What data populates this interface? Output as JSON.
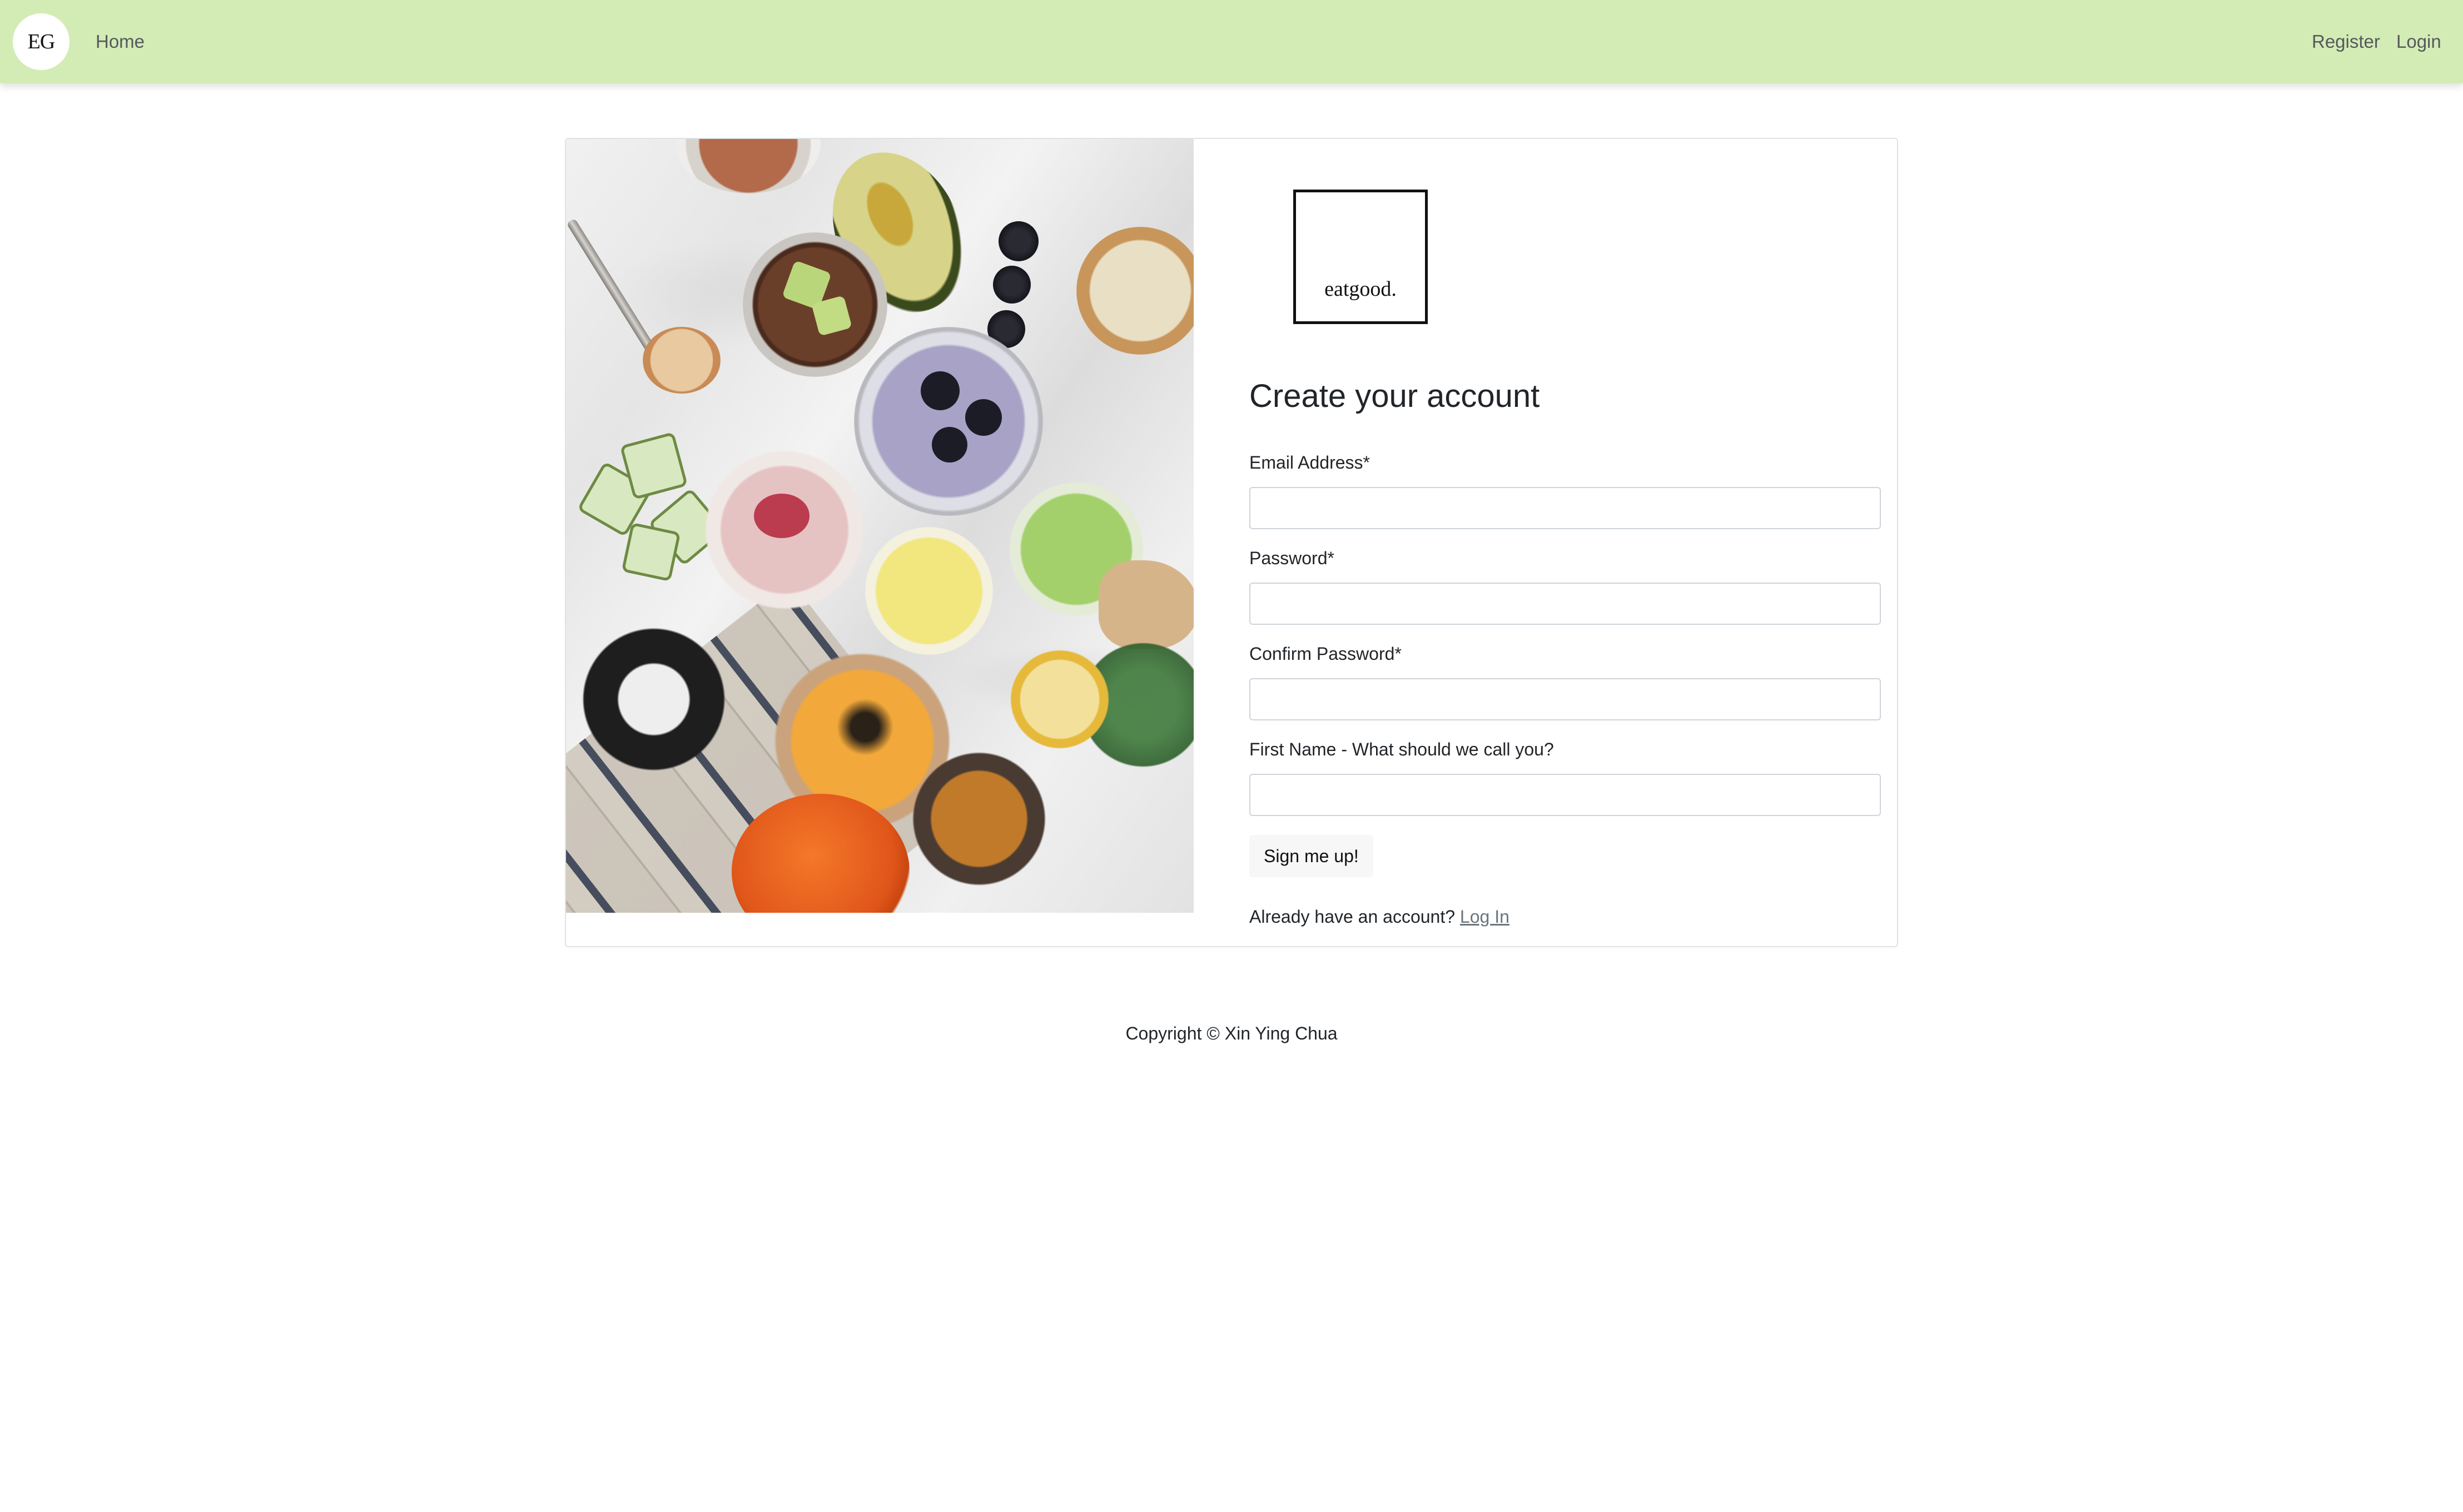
{
  "navbar": {
    "brand": "EG",
    "home_label": "Home",
    "register_label": "Register",
    "login_label": "Login",
    "background_color": "#d3ecb5"
  },
  "logo": {
    "text": "eatgood."
  },
  "form": {
    "title": "Create your account",
    "fields": [
      {
        "label": "Email Address*",
        "value": ""
      },
      {
        "label": "Password*",
        "value": ""
      },
      {
        "label": "Confirm Password*",
        "value": ""
      },
      {
        "label": "First Name - What should we call you?",
        "value": ""
      }
    ],
    "submit_label": "Sign me up!",
    "login_prompt": "Already have an account?",
    "login_link_label": "Log In"
  },
  "footer": {
    "copyright": "Copyright © Xin Ying Chua"
  }
}
